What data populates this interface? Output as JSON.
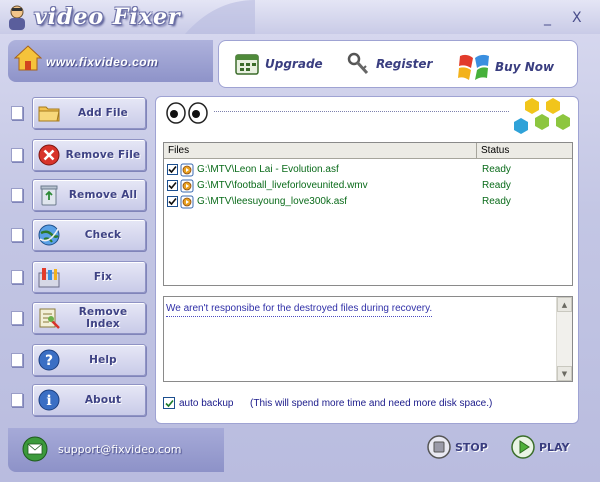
{
  "window": {
    "title": "video Fixer",
    "minimize": "_",
    "close": "X"
  },
  "header": {
    "site_url": "www.fixvideo.com",
    "links": {
      "upgrade": "Upgrade",
      "register": "Register",
      "buynow": "Buy Now"
    }
  },
  "sidebar": {
    "items": [
      {
        "label": "Add File",
        "icon": "folder-icon"
      },
      {
        "label": "Remove File",
        "icon": "remove-x-icon"
      },
      {
        "label": "Remove All",
        "icon": "recycle-bin-icon"
      },
      {
        "label": "Check",
        "icon": "globe-check-icon"
      },
      {
        "label": "Fix",
        "icon": "fix-tools-icon"
      },
      {
        "label": "Remove Index",
        "icon": "remove-index-icon"
      },
      {
        "label": "Help",
        "icon": "help-icon"
      },
      {
        "label": "About",
        "icon": "info-icon"
      }
    ]
  },
  "table": {
    "columns": [
      "Files",
      "Status"
    ],
    "rows": [
      {
        "file": "G:\\MTV\\Leon Lai - Evolution.asf",
        "status": "Ready",
        "checked": true
      },
      {
        "file": "G:\\MTV\\football_liveforloveunited.wmv",
        "status": "Ready",
        "checked": true
      },
      {
        "file": "G:\\MTV\\leesuyoung_love300k.asf",
        "status": "Ready",
        "checked": true
      }
    ]
  },
  "log": {
    "message": "We aren't responsibe for the destroyed files during recovery."
  },
  "backup": {
    "label": "auto backup",
    "checked": true,
    "note": "(This will spend more time and need more disk space.)"
  },
  "footer": {
    "support_email": "support@fixvideo.com",
    "stop_label": "STOP",
    "play_label": "PLAY"
  },
  "colors": {
    "accent": "#3e4284",
    "file_text": "#0a6b1a",
    "log_text": "#3030a8"
  }
}
